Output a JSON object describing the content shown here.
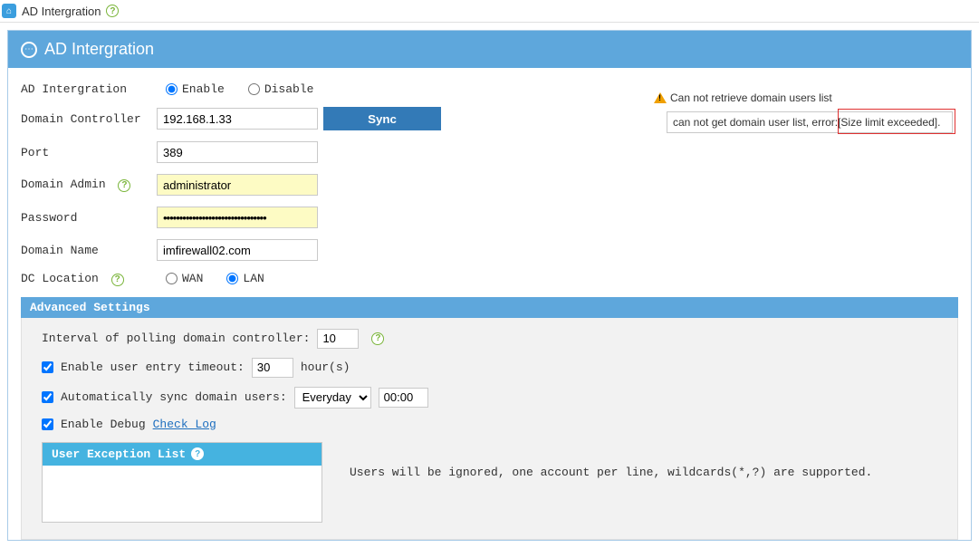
{
  "topbar": {
    "title": "AD Intergration"
  },
  "panel": {
    "title": "AD Intergration"
  },
  "form": {
    "adIntegrationLabel": "AD Intergration",
    "enableLabel": "Enable",
    "disableLabel": "Disable",
    "domainControllerLabel": "Domain Controller",
    "domainController": "192.168.1.33",
    "syncButton": "Sync",
    "portLabel": "Port",
    "port": "389",
    "domainAdminLabel": "Domain Admin",
    "domainAdmin": "administrator",
    "passwordLabel": "Password",
    "password": "••••••••••••••••••••••••••••••••",
    "domainNameLabel": "Domain Name",
    "domainName": "imfirewall02.com",
    "dcLocationLabel": "DC Location",
    "wanLabel": "WAN",
    "lanLabel": "LAN"
  },
  "warning": {
    "line1": "Can not retrieve domain users list",
    "line2a": "can not get domain user list, error:",
    "line2b": "[Size limit exceeded]."
  },
  "advanced": {
    "header": "Advanced Settings",
    "pollingLabel": "Interval of polling domain controller:",
    "pollingValue": "10",
    "timeoutLabel": "Enable user entry timeout:",
    "timeoutValue": "30",
    "timeoutUnit": "hour(s)",
    "autoSyncLabel": "Automatically sync domain users:",
    "autoSyncDay": "Everyday",
    "autoSyncTime": "00:00",
    "debugLabel": "Enable Debug",
    "checkLogLink": "Check Log",
    "uelHeader": "User Exception List",
    "uelNote": "Users will be ignored, one account per line, wildcards(*,?) are supported."
  }
}
